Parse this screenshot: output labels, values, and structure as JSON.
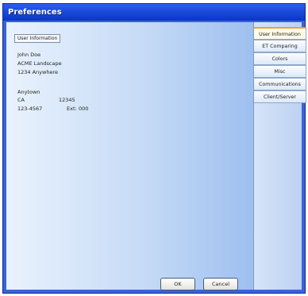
{
  "window": {
    "title": "Preferences"
  },
  "panel": {
    "group_label": "User Information",
    "name": "John Doe",
    "company": "ACME Landscape",
    "address": "1234 Anywhere",
    "city": "Anytown",
    "state": "CA",
    "zip": "12345",
    "phone": "123-4567",
    "ext_label": "Ext:",
    "ext_value": "000"
  },
  "tabs": [
    {
      "label": "User Information",
      "active": true
    },
    {
      "label": "ET Comparing",
      "active": false
    },
    {
      "label": "Colors",
      "active": false
    },
    {
      "label": "Misc",
      "active": false
    },
    {
      "label": "Communications",
      "active": false
    },
    {
      "label": "Client/Server",
      "active": false
    }
  ],
  "buttons": {
    "ok": "OK",
    "cancel": "Cancel"
  }
}
